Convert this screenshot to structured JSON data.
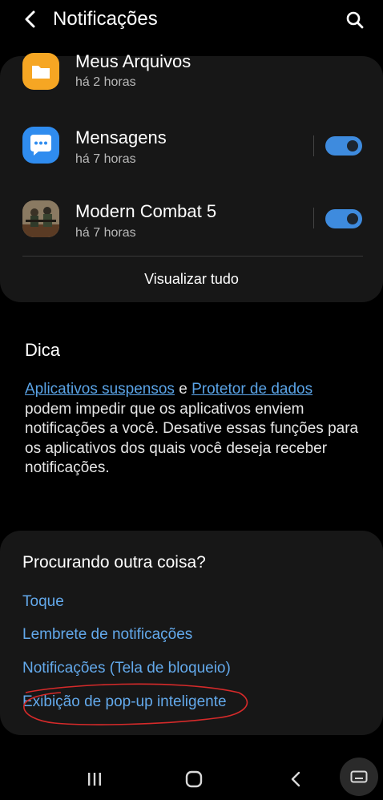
{
  "header": {
    "title": "Notificações",
    "back_icon": "back-arrow-icon",
    "search_icon": "search-icon"
  },
  "recent_apps": [
    {
      "name": "Meus Arquivos",
      "time": "há 2 horas",
      "icon": "folder-icon",
      "color": "#f6a623",
      "toggle_on": null
    },
    {
      "name": "Mensagens",
      "time": "há 7 horas",
      "icon": "chat-icon",
      "color": "#2f8cef",
      "toggle_on": true
    },
    {
      "name": "Modern Combat 5",
      "time": "há 7 horas",
      "icon": "game-icon",
      "color": "#6b5a44",
      "toggle_on": true
    }
  ],
  "view_all_label": "Visualizar tudo",
  "tip": {
    "heading": "Dica",
    "link1": "Aplicativos suspensos",
    "conjunction": " e ",
    "link2": "Protetor de dados",
    "body": " podem impedir que os aplicativos enviem notificações a você. Desative essas funções para os aplicativos dos quais você deseja receber notificações."
  },
  "looking_for": {
    "title": "Procurando outra coisa?",
    "links": [
      "Toque",
      "Lembrete de notificações",
      "Notificações (Tela de bloqueio)",
      "Exibição de pop-up inteligente"
    ]
  },
  "colors": {
    "accent": "#3e8bde",
    "link": "#63a9eb",
    "annotation": "#d62a2a"
  }
}
